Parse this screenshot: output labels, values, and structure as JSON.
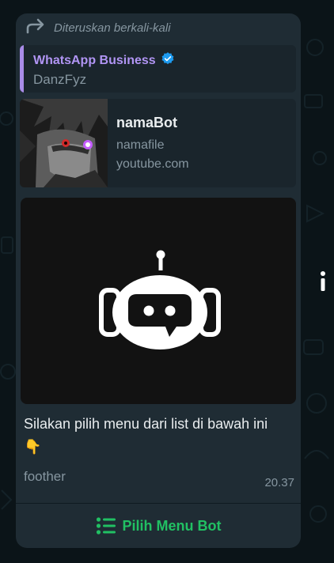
{
  "message": {
    "forwarded_label": "Diteruskan berkali-kali",
    "quote": {
      "name": "WhatsApp Business",
      "text": "DanzFyz"
    },
    "link_preview": {
      "title": "namaBot",
      "description": "namafile",
      "domain": "youtube.com"
    },
    "caption": "Silakan pilih menu dari list di bawah ini",
    "caption_emoji": "👇",
    "footer": "foother",
    "time": "20.37",
    "menu_button_label": "Pilih Menu Bot"
  },
  "icons": {
    "forward": "forward-arrow-icon",
    "verified": "verified-badge-icon",
    "bot": "robot-icon",
    "list": "list-icon",
    "info": "info-icon"
  },
  "colors": {
    "bubble": "#1f2c34",
    "accent_green": "#21c063",
    "quote_purple": "#b195f4",
    "verified_blue": "#1d9bf0"
  }
}
